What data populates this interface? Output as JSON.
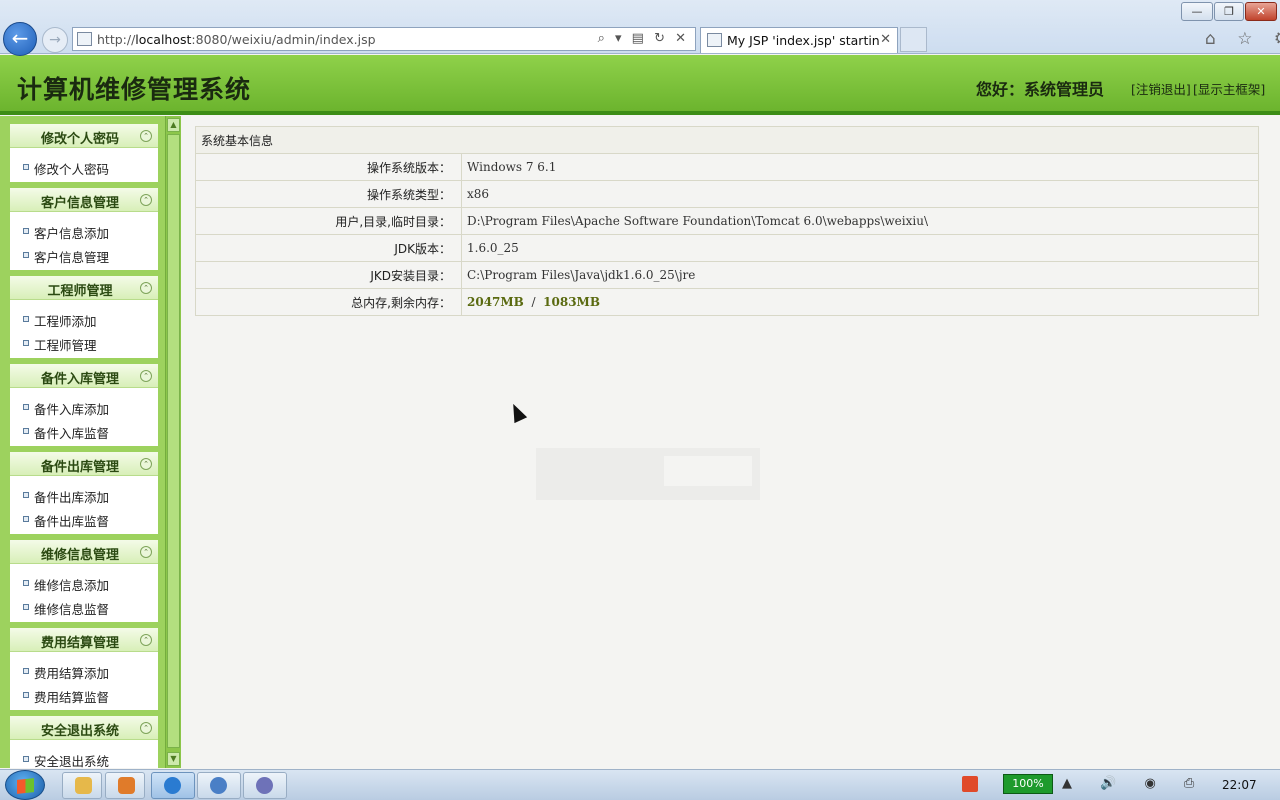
{
  "browser": {
    "url_prefix": "http://",
    "url_host": "localhost",
    "url_rest": ":8080/weixiu/admin/index.jsp",
    "tab_title": "My JSP 'index.jsp' startin...",
    "back_glyph": "←",
    "forward_glyph": "→",
    "tab_close": "✕",
    "minimize": "—",
    "maximize": "❐",
    "close": "✕",
    "address_tools": "⌕ ▾ ▤ ↻ ✕",
    "right_icons": "⌂ ☆ ⚙"
  },
  "header": {
    "app_title": "计算机维修管理系统",
    "greeting": "您好：系统管理员",
    "logout": "[注销退出]",
    "show_frame": "[显示主框架]"
  },
  "sidebar": {
    "groups": [
      {
        "title": "修改个人密码",
        "items": [
          "修改个人密码"
        ]
      },
      {
        "title": "客户信息管理",
        "items": [
          "客户信息添加",
          "客户信息管理"
        ]
      },
      {
        "title": "工程师管理",
        "items": [
          "工程师添加",
          "工程师管理"
        ]
      },
      {
        "title": "备件入库管理",
        "items": [
          "备件入库添加",
          "备件入库监督"
        ]
      },
      {
        "title": "备件出库管理",
        "items": [
          "备件出库添加",
          "备件出库监督"
        ]
      },
      {
        "title": "维修信息管理",
        "items": [
          "维修信息添加",
          "维修信息监督"
        ]
      },
      {
        "title": "费用结算管理",
        "items": [
          "费用结算添加",
          "费用结算监督"
        ]
      },
      {
        "title": "安全退出系统",
        "items": [
          "安全退出系统"
        ]
      }
    ],
    "toggle_glyph": "⌃"
  },
  "info": {
    "caption": "系统基本信息",
    "rows": [
      {
        "key": "操作系统版本：",
        "value": "Windows 7  6.1"
      },
      {
        "key": "操作系统类型：",
        "value": "x86"
      },
      {
        "key": "用户,目录,临时目录：",
        "value": "D:\\Program Files\\Apache Software Foundation\\Tomcat 6.0\\webapps\\weixiu\\"
      },
      {
        "key": "JDK版本：",
        "value": "1.6.0_25"
      },
      {
        "key": "JKD安装目录：",
        "value": "C:\\Program Files\\Java\\jdk1.6.0_25\\jre"
      }
    ],
    "memory": {
      "key": "总内存,剩余内存：",
      "total": "2047MB",
      "separator": "  /  ",
      "free": "1083MB"
    }
  },
  "taskbar": {
    "battery": "100%",
    "tray_icons": "▲ 🔊 ◉ ⎙",
    "clock": "22:07"
  }
}
